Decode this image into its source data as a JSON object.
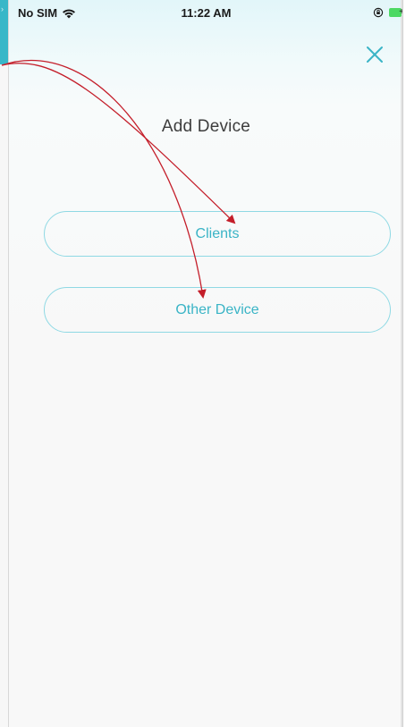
{
  "status_bar": {
    "carrier": "No SIM",
    "time": "11:22 AM"
  },
  "header": {
    "close_icon": "close-icon"
  },
  "main": {
    "title": "Add Device",
    "options": [
      {
        "label": "Clients"
      },
      {
        "label": "Other Device"
      }
    ]
  },
  "colors": {
    "accent": "#3ab4c6",
    "button_border": "#8fd9e4",
    "annotation_arrow": "#c41e2a",
    "title_text": "#3d3d3d"
  }
}
